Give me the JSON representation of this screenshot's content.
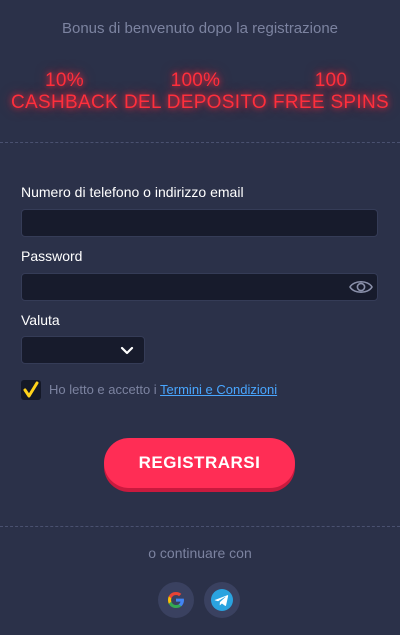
{
  "bonus": {
    "title": "Bonus di benvenuto dopo la registrazione",
    "items": [
      {
        "line1": "10%",
        "line2": "CASHBACK"
      },
      {
        "line1": "100%",
        "line2": "DEL DEPOSITO"
      },
      {
        "line1": "100",
        "line2": "FREE SPINS"
      }
    ],
    "accent_color": "#ff2f3c"
  },
  "form": {
    "login_label": "Numero di telefono o indirizzo email",
    "login_value": "",
    "password_label": "Password",
    "password_value": "",
    "currency_label": "Valuta",
    "currency_value": "",
    "terms_prefix": "Ho letto e accetto i ",
    "terms_link": "Termini e Condizioni",
    "terms_checked": true,
    "submit_label": "REGISTRARSI"
  },
  "social": {
    "continue_label": "o continuare con",
    "providers": [
      {
        "icon": "google-icon"
      },
      {
        "icon": "telegram-icon"
      }
    ]
  }
}
